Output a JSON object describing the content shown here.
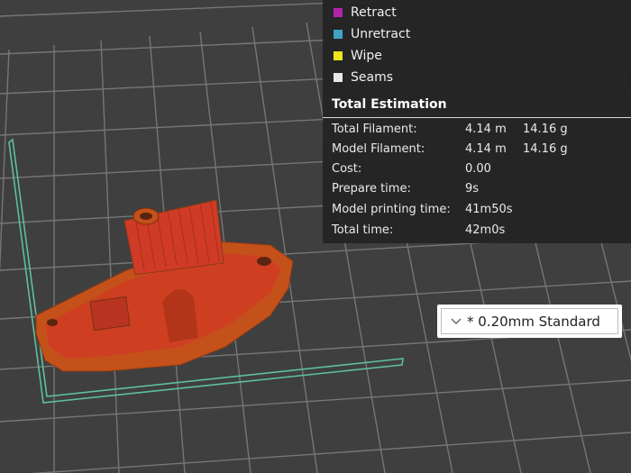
{
  "legend": {
    "items": [
      {
        "label": "Retract",
        "color": "#b024a8"
      },
      {
        "label": "Unretract",
        "color": "#3fa3c3"
      },
      {
        "label": "Wipe",
        "color": "#ece61e"
      },
      {
        "label": "Seams",
        "color": "#e8e8e8"
      }
    ]
  },
  "estimation": {
    "title": "Total Estimation",
    "rows": [
      {
        "label": "Total Filament:",
        "value1": "4.14 m",
        "value2": "14.16 g"
      },
      {
        "label": "Model Filament:",
        "value1": "4.14 m",
        "value2": "14.16 g"
      },
      {
        "label": "Cost:",
        "value1": "0.00",
        "value2": ""
      },
      {
        "label": "Prepare time:",
        "value1": "9s",
        "value2": ""
      },
      {
        "label": "Model printing time:",
        "value1": "41m50s",
        "value2": ""
      },
      {
        "label": "Total time:",
        "value1": "42m0s",
        "value2": ""
      }
    ]
  },
  "preset": {
    "label": "* 0.20mm Standard",
    "icon": "chevron-down-icon"
  },
  "colors": {
    "model": "#c4501a",
    "model_fill": "#d03c24",
    "plate_bg": "#3f3f40",
    "grid": "#7a7a7a",
    "border": "#5fbf9a"
  }
}
